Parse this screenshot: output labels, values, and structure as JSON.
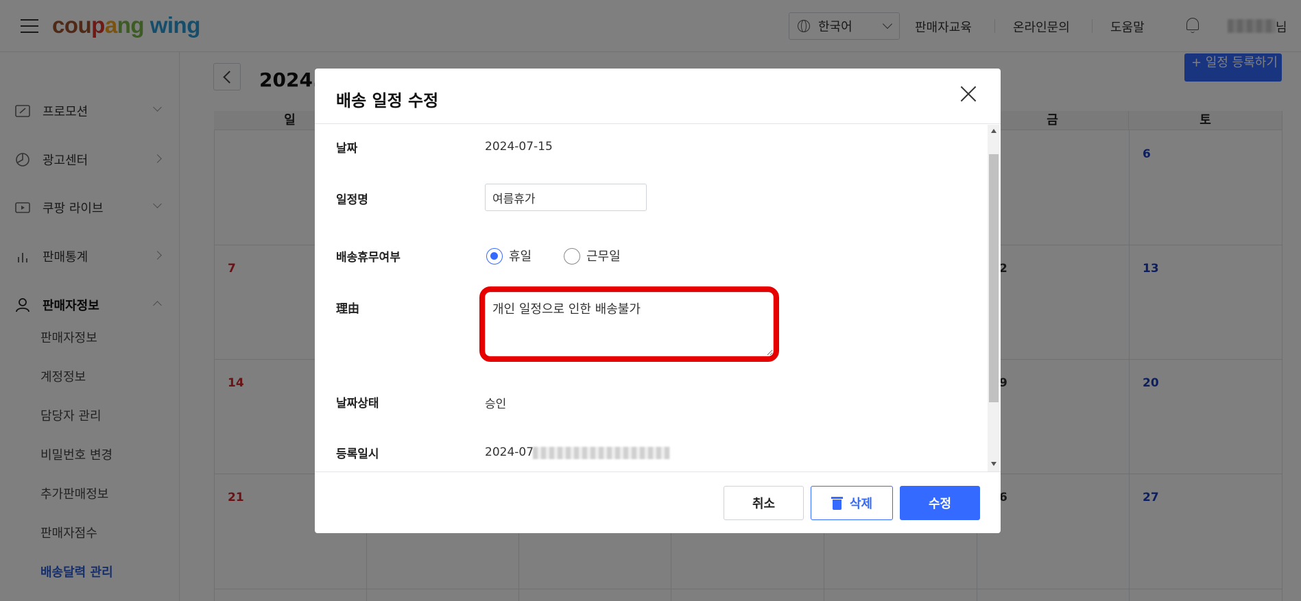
{
  "header": {
    "logo": [
      "cou",
      "p",
      "a",
      "ng",
      " wing"
    ],
    "language": "한국어",
    "links": [
      "판매자교육",
      "온라인문의",
      "도움말"
    ],
    "user_suffix": "님"
  },
  "sidebar": {
    "items": [
      {
        "label": "프로모션",
        "icon": "promotion-icon",
        "arrow": "down"
      },
      {
        "label": "광고센터",
        "icon": "ad-center-icon",
        "arrow": "right"
      },
      {
        "label": "쿠팡 라이브",
        "icon": "live-icon",
        "arrow": "down"
      },
      {
        "label": "판매통계",
        "icon": "stats-icon",
        "arrow": "right"
      },
      {
        "label": "판매자정보",
        "icon": "user-icon",
        "arrow": "up"
      }
    ],
    "sub_items": [
      "판매자정보",
      "계정정보",
      "담당자 관리",
      "비밀번호 변경",
      "추가판매정보",
      "판매자점수",
      "배송달력 관리"
    ],
    "active_sub": "배송달력 관리"
  },
  "calendar": {
    "year_label": "2024.",
    "add_button": "+ 일정 등록하기",
    "weekdays": [
      "일",
      "금",
      "토"
    ],
    "days": {
      "row1": [
        "6"
      ],
      "row2": [
        "7",
        "2",
        "13"
      ],
      "row3": [
        "14",
        "9",
        "20"
      ],
      "row4": [
        "21",
        "6",
        "27"
      ]
    }
  },
  "modal": {
    "title": "배송 일정 수정",
    "fields": {
      "date_label": "날짜",
      "date_value": "2024-07-15",
      "name_label": "일정명",
      "name_value": "여름휴가",
      "type_label": "배송휴무여부",
      "radio_holiday": "휴일",
      "radio_workday": "근무일",
      "selected": "휴일",
      "reason_label": "理由",
      "reason_value": "개인 일정으로 인한 배송불가",
      "status_label": "날짜상태",
      "status_value": "승인",
      "registered_label": "등록일시",
      "registered_value_prefix": "2024-07-"
    },
    "buttons": {
      "cancel": "취소",
      "delete": "삭제",
      "save": "수정"
    },
    "colors": {
      "primary": "#346aff",
      "highlight": "#e60000"
    }
  }
}
